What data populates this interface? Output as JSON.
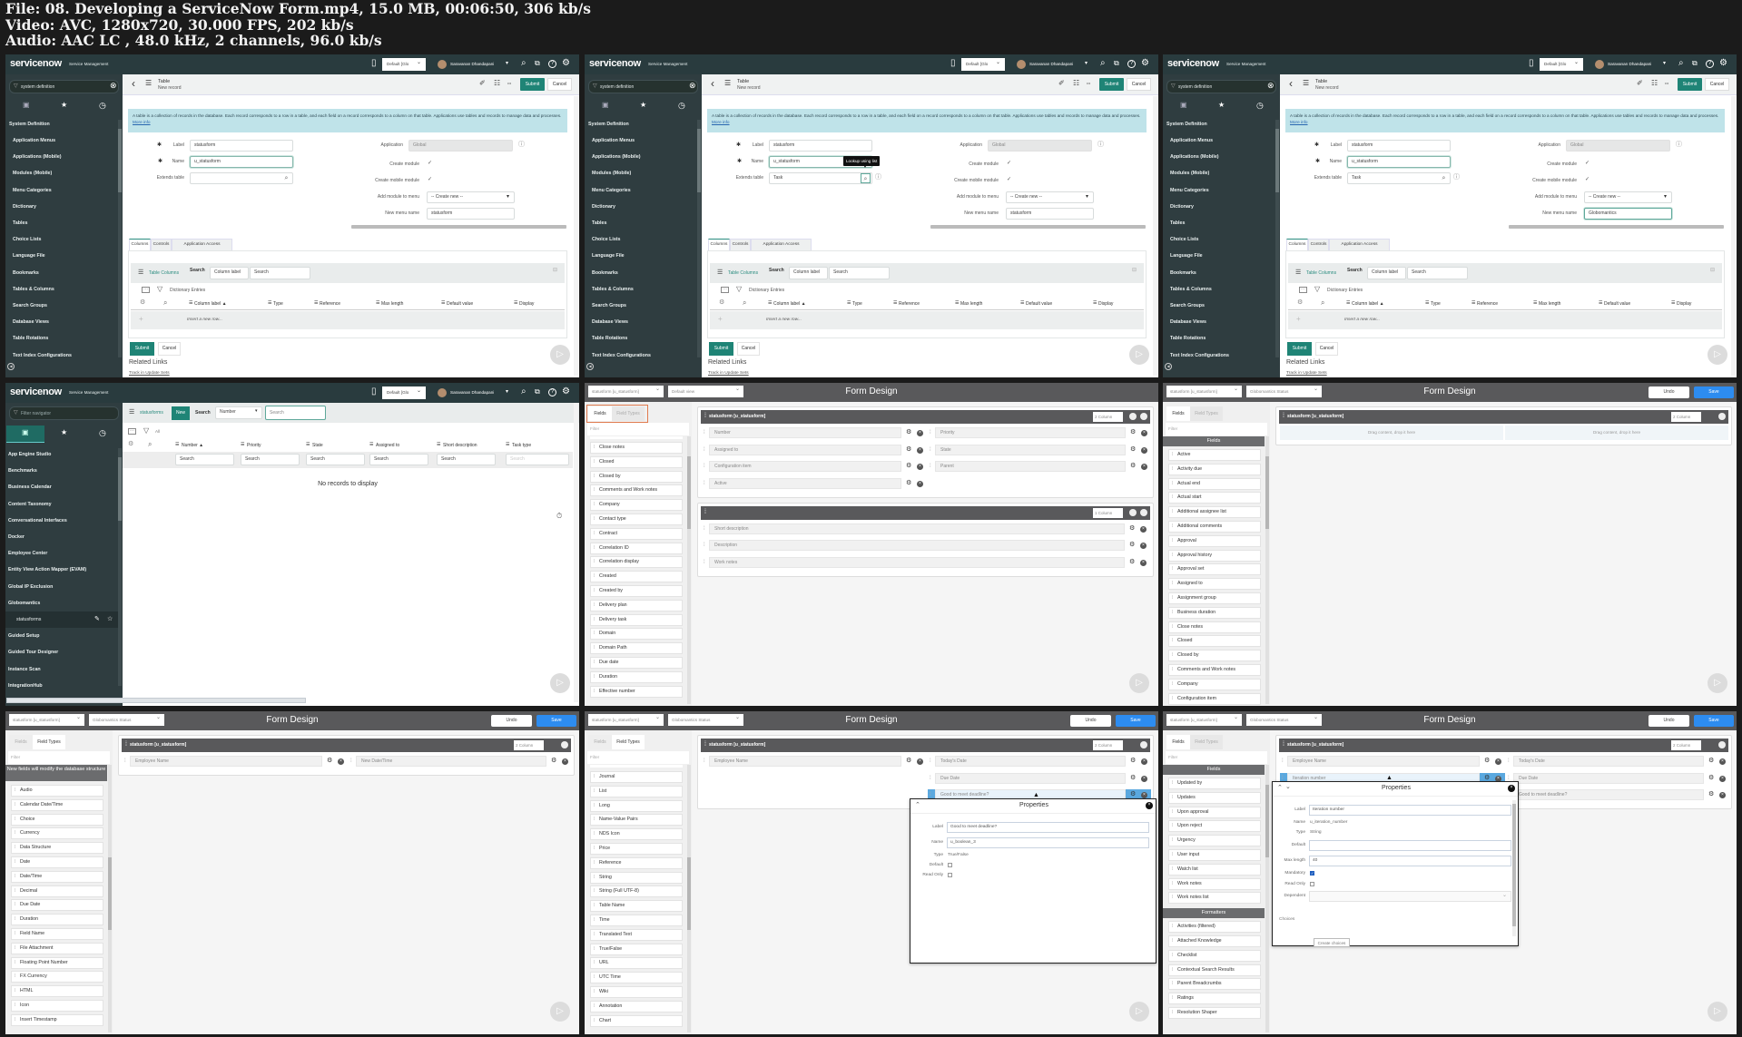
{
  "file_info": {
    "line1": "File: 08. Developing a ServiceNow Form.mp4, 15.0 MB, 00:06:50, 306 kb/s",
    "line2": "Video: AVC, 1280x720, 30.000 FPS, 202 kb/s",
    "line3": "Audio: AAC LC , 48.0 kHz, 2 channels, 96.0 kb/s"
  },
  "nav": {
    "logo": "servicenow",
    "product": "Service Management",
    "scope": "Default [Glo",
    "user": "Saravanan Dhandapani"
  },
  "record": {
    "sidebar": {
      "filter": "system definition",
      "section": "System Definition",
      "items": [
        "Application Menus",
        "Applications (Mobile)",
        "Modules (Mobile)",
        "Menu Categories",
        "Dictionary",
        "Tables",
        "Choice Lists",
        "Language File",
        "Bookmarks",
        "Tables & Columns",
        "Search Groups",
        "Database Views",
        "Table Rotations",
        "Text Index Configurations"
      ]
    },
    "header": {
      "title": "Table",
      "subtitle": "New record",
      "submit": "Submit",
      "cancel": "Cancel"
    },
    "info": {
      "text": "A table is a collection of records in the database. Each record corresponds to a row in a table, and each field on a record corresponds to a column on that table. Applications use tables and records to manage data and processes.",
      "link": "More info"
    },
    "form": {
      "label_label": "Label",
      "label_value": "statusform",
      "name_label": "Name",
      "name_value": "u_statusform",
      "extends_label": "Extends table",
      "application_label": "Application",
      "application_value": "Global",
      "create_module_label": "Create module",
      "create_mobile_label": "Create mobile module",
      "add_module_label": "Add module to menu",
      "add_module_value": "-- Create new --",
      "menu_name_label": "New menu name"
    },
    "tabs": [
      "Columns",
      "Controls",
      "Application Access"
    ],
    "related": {
      "title": "Table Columns",
      "search_label": "Search",
      "search_field": "Column label",
      "search_placeholder": "Search",
      "breadcrumb": "Dictionary Entries",
      "columns": [
        "Column label ▲",
        "Type",
        "Reference",
        "Max length",
        "Default value",
        "Display"
      ],
      "insert_row": "Insert a new row..."
    },
    "footer": {
      "submit": "Submit",
      "cancel": "Cancel",
      "related_links": "Related Links",
      "track": "Track in Update Sets"
    }
  },
  "list": {
    "sidebar": {
      "filter_placeholder": "Filter navigator",
      "items": [
        "App Engine Studio",
        "Benchmarks",
        "Business Calendar",
        "Content Taxonomy",
        "Conversational Interfaces",
        "Docker",
        "Employee Center",
        "Entity View Action Mapper (EVAM)",
        "Global IP Exclusion",
        "Globomantics",
        "statusforms",
        "Guided Setup",
        "Guided Tour Designer",
        "Instance Scan",
        "IntegrationHub"
      ]
    },
    "title": "statusforms",
    "new": "New",
    "search_label": "Search",
    "search_field": "Number",
    "search_placeholder": "Search",
    "all": "All",
    "columns": [
      "Number ▲",
      "Priority",
      "State",
      "Assigned to",
      "Short description",
      "Task type"
    ],
    "column_search": "Search",
    "empty": "No records to display"
  },
  "form_design": {
    "title": "Form Design",
    "table_select": "statusform [u_statusform]",
    "undo": "Undo",
    "save": "Save",
    "fields_tab": "Fields",
    "field_types_tab": "Field Types",
    "filter_placeholder": "Filter",
    "fields_header": "Fields",
    "formatters_header": "Formatters",
    "field_types_header": "New fields will modify the database structure",
    "section_title": "statusform [u_statusform]",
    "two_column": "2 Column",
    "one_column": "1 Column",
    "drop_here": "Drag content, drop it here",
    "properties": "Properties"
  },
  "frames": [
    {
      "type": "record",
      "extends_value": "",
      "menu_name_value": "statusform"
    },
    {
      "type": "record",
      "extends_value": "Task",
      "menu_name_value": "statusform",
      "tooltip": "Lookup using list"
    },
    {
      "type": "record",
      "extends_value": "Task",
      "menu_name_value": "Globomantics"
    },
    {
      "type": "list"
    },
    {
      "type": "form",
      "view": "Default view",
      "active_tab": "fields",
      "buttons": false,
      "highlight_tabs": true,
      "list_sections": [
        {
          "header": "",
          "items": [
            "Close notes",
            "Closed",
            "Closed by",
            "Comments and Work notes",
            "Company",
            "Contact type",
            "Contract",
            "Correlation ID",
            "Correlation display",
            "Created",
            "Created by",
            "Delivery plan",
            "Delivery task",
            "Domain",
            "Domain Path",
            "Due date",
            "Duration",
            "Effective number"
          ]
        }
      ],
      "sections": [
        {
          "title": "statusform [u_statusform]",
          "columns": "2 Column",
          "left": [
            "Number",
            "Assigned to",
            "Configuration item",
            "Active"
          ],
          "right": [
            "Priority",
            "State",
            "Parent"
          ]
        },
        {
          "title": "",
          "columns": "1 Column",
          "left": [
            "Short description",
            "Description",
            "Work notes"
          ],
          "right": []
        }
      ]
    },
    {
      "type": "form",
      "view": "Globomantics Status",
      "active_tab": "fields",
      "buttons": true,
      "list_sections": [
        {
          "header": "Fields",
          "items": [
            "Active",
            "Activity due",
            "Actual end",
            "Actual start",
            "Additional assignee list",
            "Additional comments",
            "Approval",
            "Approval history",
            "Approval set",
            "Assigned to",
            "Assignment group",
            "Business duration",
            "Close notes",
            "Closed",
            "Closed by",
            "Comments and Work notes",
            "Company",
            "Configuration item"
          ]
        }
      ],
      "sections": [
        {
          "title": "statusform [u_statusform]",
          "columns": "2 Column",
          "left": [],
          "right": [],
          "drop": true
        }
      ]
    },
    {
      "type": "form",
      "view": "Globomantics Status",
      "active_tab": "types",
      "buttons": true,
      "list_sections": [
        {
          "header": "New fields will modify the database structure",
          "items": [
            "Audio",
            "Calendar Date/Time",
            "Choice",
            "Currency",
            "Data Structure",
            "Date",
            "Date/Time",
            "Decimal",
            "Due Date",
            "Duration",
            "Field Name",
            "File Attachment",
            "Floating Point Number",
            "FX Currency",
            "HTML",
            "Icon",
            "Insert Timestamp"
          ]
        }
      ],
      "sections": [
        {
          "title": "statusform [u_statusform]",
          "columns": "2 Column",
          "left": [
            "Employee Name"
          ],
          "right": [
            "New Date/Time"
          ]
        }
      ]
    },
    {
      "type": "form",
      "view": "Globomantics Status",
      "active_tab": "types",
      "buttons": true,
      "list_sections": [
        {
          "header": "",
          "items": [
            "Journal",
            "List",
            "Long",
            "Name-Value Pairs",
            "NDS Icon",
            "Price",
            "Reference",
            "String",
            "String (Full UTF-8)",
            "Table Name",
            "Time",
            "Translated Text",
            "True/False",
            "URL",
            "UTC Time",
            "Wiki",
            "Annotation",
            "Chart"
          ]
        }
      ],
      "sections": [
        {
          "title": "statusform [u_statusform]",
          "columns": "2 Column",
          "left": [
            "Employee Name"
          ],
          "right": [
            "Today's Date",
            "Due Date",
            "Good to meet deadline?"
          ],
          "highlight": "right-2"
        }
      ],
      "properties": {
        "rows": [
          {
            "label": "Label",
            "kind": "input",
            "value": "Good to meet deadline?"
          },
          {
            "label": "Name",
            "kind": "input",
            "value": "u_boolean_3"
          },
          {
            "label": "Type",
            "kind": "text",
            "value": "True/False"
          },
          {
            "label": "Default",
            "kind": "check",
            "checked": false
          },
          {
            "label": "Read Only",
            "kind": "check",
            "checked": false
          }
        ]
      }
    },
    {
      "type": "form",
      "view": "Globomantics Status",
      "active_tab": "fields",
      "buttons": true,
      "list_sections": [
        {
          "header": "Fields",
          "items": [
            "Updated by",
            "Updates",
            "Upon approval",
            "Upon reject",
            "Urgency",
            "User input",
            "Watch list",
            "Work notes",
            "Work notes list"
          ]
        },
        {
          "header": "Formatters",
          "items": [
            "Activities (filtered)",
            "Attached Knowledge",
            "Checklist",
            "Contextual Search Results",
            "Parent Breadcrumbs",
            "Ratings",
            "Resolution Shaper"
          ]
        }
      ],
      "sections": [
        {
          "title": "statusform [u_statusform]",
          "columns": "2 Column",
          "left": [
            "Employee Name",
            "Iteration number"
          ],
          "right": [
            "Today's Date",
            "Due Date",
            "Good to meet deadline?"
          ],
          "highlight": "left-1"
        }
      ],
      "properties": {
        "rows": [
          {
            "label": "Label",
            "kind": "input",
            "value": "Iteration number"
          },
          {
            "label": "Name",
            "kind": "text",
            "value": "u_iteration_number"
          },
          {
            "label": "Type",
            "kind": "text",
            "value": "String"
          },
          {
            "label": "Default",
            "kind": "input",
            "value": ""
          },
          {
            "label": "Max length",
            "kind": "input",
            "value": "40"
          },
          {
            "label": "Mandatory",
            "kind": "check",
            "checked": true
          },
          {
            "label": "Read Only",
            "kind": "check",
            "checked": false
          },
          {
            "label": "Dependent",
            "kind": "select",
            "value": ""
          }
        ],
        "choices_label": "Choices",
        "create_choices": "Create choices"
      }
    }
  ]
}
